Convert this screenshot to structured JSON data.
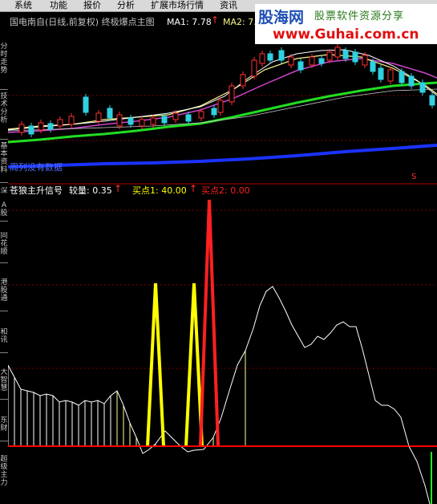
{
  "menu": {
    "items": [
      "系统",
      "功能",
      "报价",
      "分析",
      "扩展市场行情",
      "资讯"
    ]
  },
  "sidebar": {
    "tabs": [
      "分时走势",
      "技术分析",
      "基本资料",
      "深",
      "A股",
      "同花顺",
      "港股通",
      "和讯",
      "大智慧",
      "东财",
      "超级主力"
    ]
  },
  "main_chart": {
    "title": "国电南自(日线,前复权) 终极爆点主图",
    "ma1_label": "MA1: 7.78",
    "ma2_label": "MA2: 7.8",
    "no_data_text": "周列没有数据",
    "signal_mark": "S",
    "colors": {
      "ma1": "#ffffff",
      "ma2": "#f7f78c",
      "ma3": "#cc44cc",
      "ma4": "#22dd22",
      "ma5": "#1a33ff",
      "candle_up": "#ff3030",
      "candle_down": "#2fd0e0"
    }
  },
  "indicator": {
    "title": "苍狼主升信号",
    "vol_label": "较量: 0.35",
    "buy1_label": "买点1: 40.00",
    "buy2_label": "买点2: 0.00",
    "colors": {
      "title": "#ffffff",
      "vol": "#ffffff",
      "buy1": "#ffff00",
      "buy2": "#ff2020",
      "line": "#ffffff",
      "zero": "#ff0000"
    }
  },
  "banner": {
    "logo": "股海网",
    "slogan": "股票软件资源分享",
    "url": "www.Guhai.com.cn"
  }
}
